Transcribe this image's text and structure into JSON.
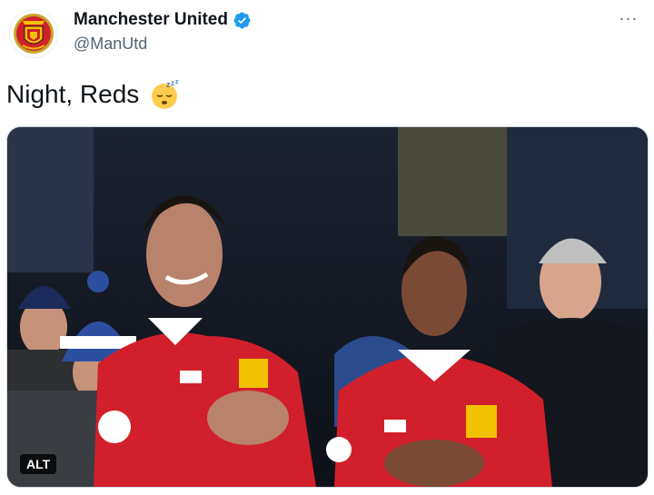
{
  "tweet": {
    "display_name": "Manchester United",
    "handle": "@ManUtd",
    "text": "Night, Reds",
    "verified": true,
    "more_label": "···",
    "alt_badge": "ALT"
  },
  "colors": {
    "accent": "#1d9bf0",
    "kit_red": "#d1202b",
    "text": "#0f1419",
    "secondary": "#536471"
  },
  "icons": {
    "avatar": "man-utd-crest-icon",
    "verified": "verified-badge-icon",
    "emoji": "sleeping-face-emoji",
    "more": "more-options-icon"
  }
}
